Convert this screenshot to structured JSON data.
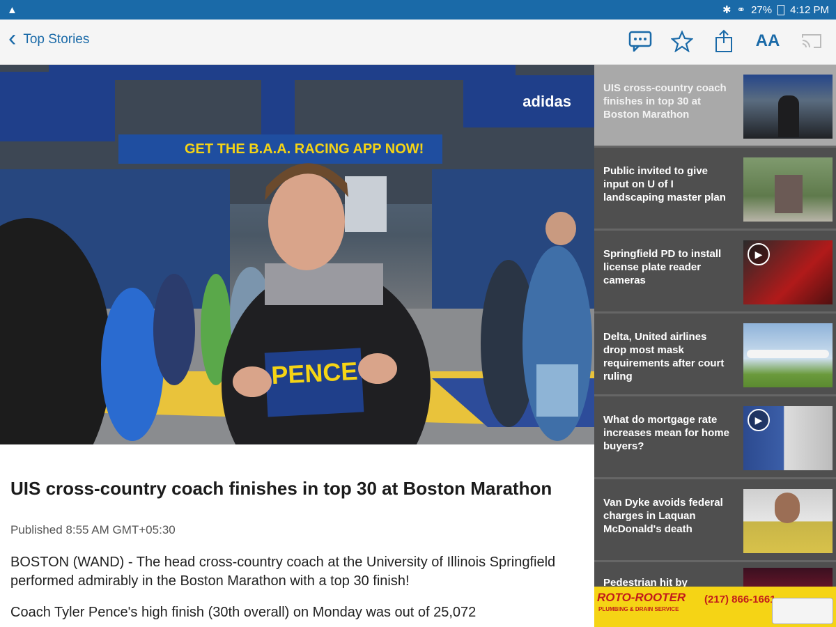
{
  "status": {
    "left_icon": "notification-icon",
    "bluetooth": "bluetooth-icon",
    "wifi": "wifi-icon",
    "battery": "27%",
    "time": "4:12 PM"
  },
  "nav": {
    "back_label": "Top Stories"
  },
  "toolbar": {
    "icons": [
      "comment-icon",
      "star-icon",
      "share-icon",
      "text-size-icon",
      "cast-icon"
    ],
    "text_size_label": "AA"
  },
  "hero": {
    "banner_text": "GET THE B.A.A. RACING APP NOW!",
    "sponsor_banner": "adidas",
    "bib_text": "PENCE"
  },
  "article": {
    "headline": "UIS cross-country coach finishes in top 30 at Boston Marathon",
    "published": "Published 8:55 AM GMT+05:30",
    "paragraphs": [
      "BOSTON (WAND) - The head cross-country coach at the University of Illinois Springfield performed admirably in the Boston Marathon with a top 30 finish!",
      "Coach Tyler Pence's high finish (30th overall) on Monday was out of 25,072"
    ]
  },
  "sidebar": {
    "items": [
      {
        "title": "UIS cross-country coach finishes in top 30 at Boston Marathon",
        "active": true,
        "video": false
      },
      {
        "title": "Public invited to give input on U of I landscaping master plan",
        "active": false,
        "video": false
      },
      {
        "title": "Springfield PD to install license plate reader cameras",
        "active": false,
        "video": true
      },
      {
        "title": "Delta, United airlines drop most mask requirements after court ruling",
        "active": false,
        "video": false
      },
      {
        "title": "What do mortgage rate increases mean for home buyers?",
        "active": false,
        "video": true
      },
      {
        "title": "Van Dyke avoids federal charges in Laquan McDonald's death",
        "active": false,
        "video": false
      },
      {
        "title": "Pedestrian hit by",
        "active": false,
        "video": false
      }
    ]
  },
  "ad": {
    "brand": "ROTO-ROOTER",
    "phone": "(217) 866-1661",
    "tagline": "PLUMBING & DRAIN SERVICE"
  }
}
